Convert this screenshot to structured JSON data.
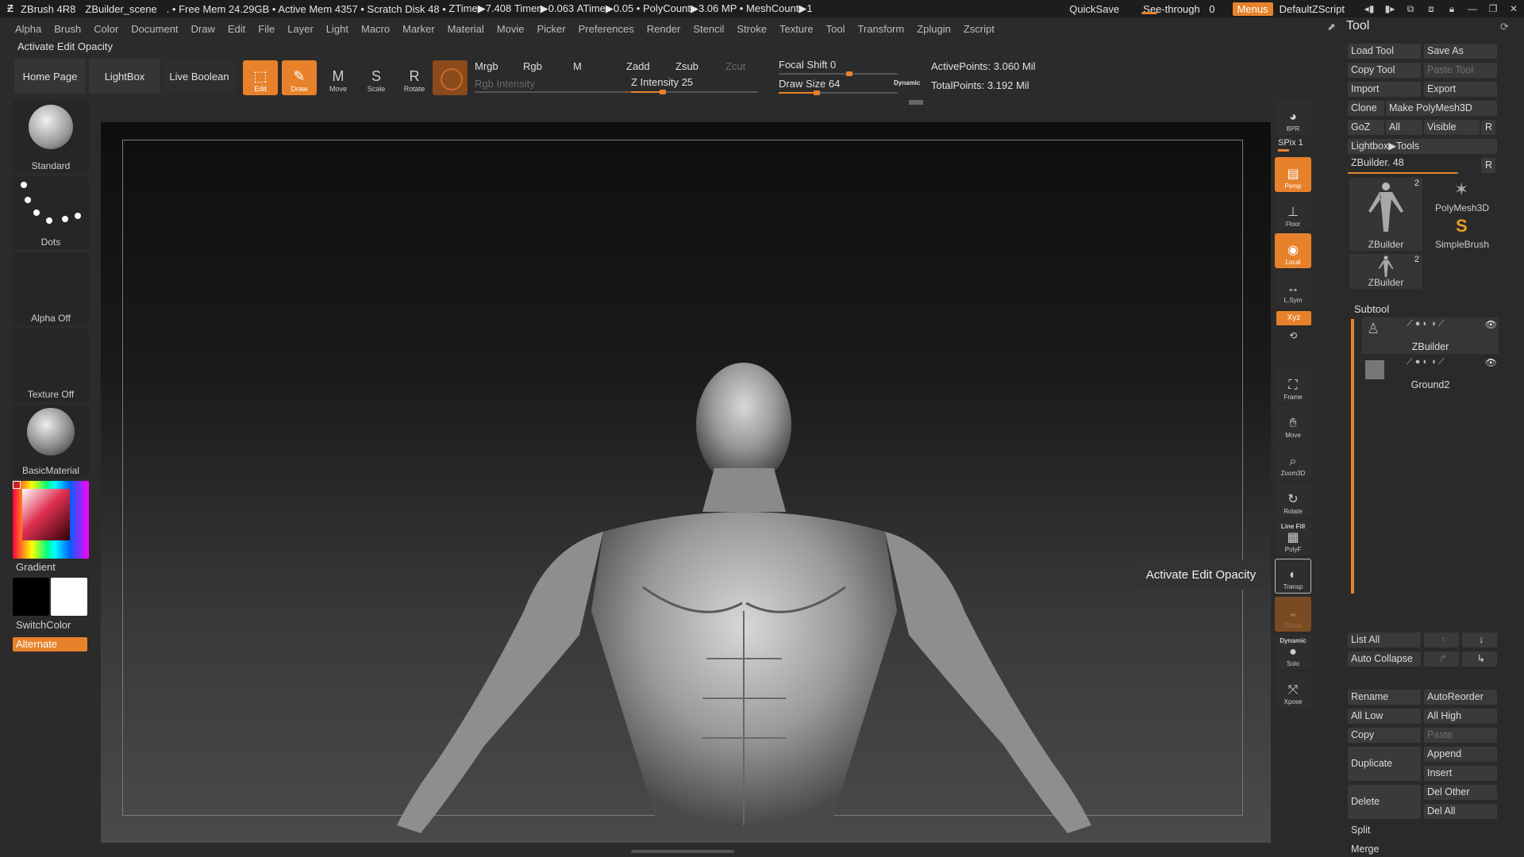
{
  "titlebar": {
    "app": "ZBrush 4R8",
    "scene": "ZBuilder_scene",
    "free_mem": ". • Free Mem 24.29GB",
    "active_mem": "• Active Mem 4357",
    "scratch": "• Scratch Disk 48 •",
    "ztime": "ZTime▶7.408",
    "timer": "Timer▶0.063",
    "atime": "ATime▶0.05 •",
    "polycount": "PolyCount▶3.06 MP •",
    "meshcount": "MeshCount▶1",
    "quicksave": "QuickSave",
    "see_through": "See-through",
    "see_through_value": "0",
    "menus": "Menus",
    "script": "DefaultZScript"
  },
  "menu": [
    "Alpha",
    "Brush",
    "Color",
    "Document",
    "Draw",
    "Edit",
    "File",
    "Layer",
    "Light",
    "Macro",
    "Marker",
    "Material",
    "Movie",
    "Picker",
    "Preferences",
    "Render",
    "Stencil",
    "Stroke",
    "Texture",
    "Tool",
    "Transform",
    "Zplugin",
    "Zscript"
  ],
  "hint": "Activate Edit Opacity",
  "toolbar": {
    "home": "Home Page",
    "lightbox": "LightBox",
    "live_boolean": "Live Boolean",
    "edit": "Edit",
    "draw": "Draw",
    "move": "Move",
    "scale": "Scale",
    "rotate": "Rotate",
    "mrgb": "Mrgb",
    "rgb": "Rgb",
    "m": "M",
    "rgb_intensity": "Rgb Intensity",
    "zadd": "Zadd",
    "zsub": "Zsub",
    "zcut": "Zcut",
    "z_intensity": "Z Intensity 25",
    "z_intensity_value": 25,
    "focal_shift": "Focal Shift 0",
    "draw_size": "Draw Size 64",
    "draw_size_value": 64,
    "dynamic": "Dynamic",
    "active_points": "ActivePoints: 3.060 Mil",
    "total_points": "TotalPoints: 3.192 Mil"
  },
  "left_shelf": {
    "brush": "Standard",
    "stroke": "Dots",
    "alpha": "Alpha Off",
    "texture": "Texture Off",
    "material": "BasicMaterial",
    "gradient": "Gradient",
    "switchcolor": "SwitchColor",
    "alternate": "Alternate"
  },
  "right_strip": {
    "bpr": "BPR",
    "spix": "SPix 1",
    "persp": "Persp",
    "floor": "Floor",
    "local": "Local",
    "lsym": "L.Sym",
    "xyz": "Xyz",
    "frame": "Frame",
    "move": "Move",
    "zoom3d": "Zoom3D",
    "rotate": "Rotate",
    "linefill": "Line Fill",
    "polyf": "PolyF",
    "transp": "Transp",
    "ghost": "Ghost",
    "solo": "Solo",
    "dynamic": "Dynamic",
    "xpose": "Xpose"
  },
  "tooltip": "Activate Edit Opacity",
  "tool_panel": {
    "title": "Tool",
    "load_tool": "Load Tool",
    "save_as": "Save As",
    "copy_tool": "Copy Tool",
    "paste_tool": "Paste Tool",
    "import": "Import",
    "export": "Export",
    "clone": "Clone",
    "make_polymesh": "Make PolyMesh3D",
    "goz": "GoZ",
    "all": "All",
    "visible": "Visible",
    "r": "R",
    "lightbox_tools": "Lightbox▶Tools",
    "zbuilder_slider": "ZBuilder. 48",
    "thumbs": [
      {
        "name": "ZBuilder",
        "count": "2"
      },
      {
        "name": "PolyMesh3D",
        "count": ""
      },
      {
        "name": "SimpleBrush",
        "count": ""
      },
      {
        "name": "ZBuilder",
        "count": "2"
      }
    ],
    "subtool": {
      "title": "Subtool",
      "items": [
        {
          "name": "ZBuilder"
        },
        {
          "name": "Ground2"
        }
      ]
    },
    "list_all": "List All",
    "auto_collapse": "Auto Collapse",
    "rename": "Rename",
    "auto_reorder": "AutoReorder",
    "all_low": "All Low",
    "all_high": "All High",
    "copy": "Copy",
    "paste": "Paste",
    "duplicate": "Duplicate",
    "append": "Append",
    "insert": "Insert",
    "delete": "Delete",
    "del_other": "Del Other",
    "del_all": "Del All",
    "split": "Split",
    "merge": "Merge"
  },
  "colors": {
    "accent": "#e8822a",
    "panel": "#2a2a2a",
    "background": "#2b2b2b"
  }
}
